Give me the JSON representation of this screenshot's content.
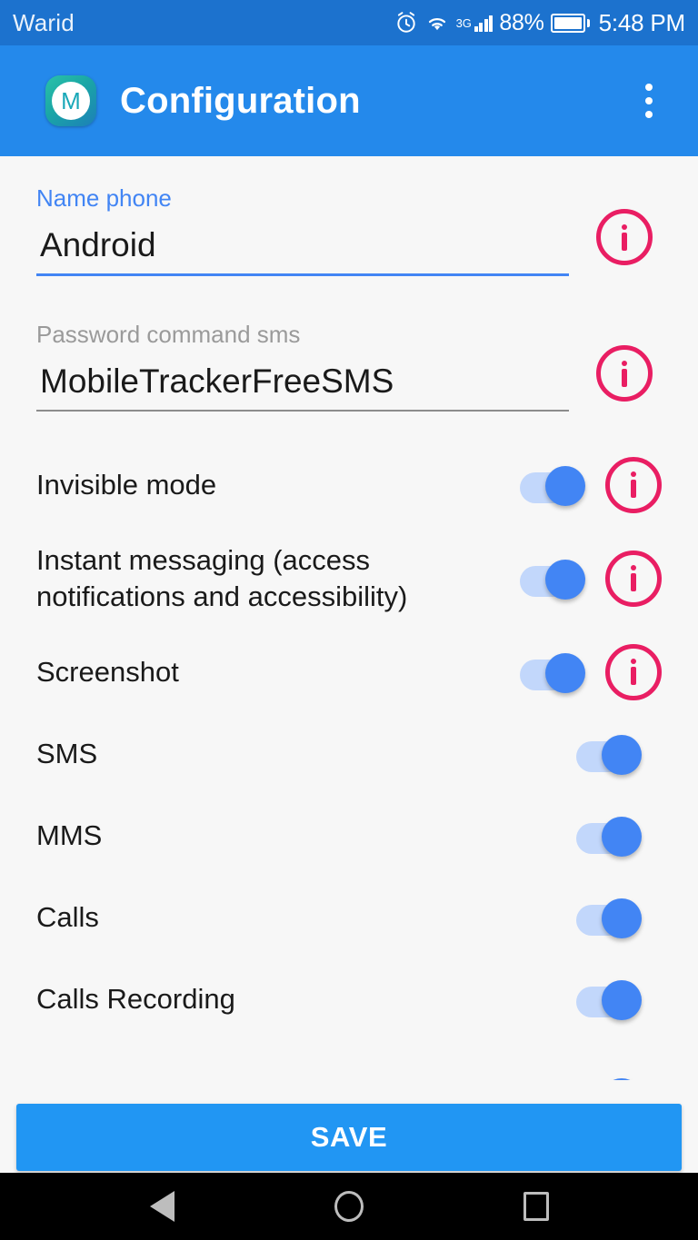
{
  "status_bar": {
    "carrier": "Warid",
    "battery_percent": "88%",
    "network_type": "3G",
    "clock": "5:48 PM",
    "icons": [
      "alarm-icon",
      "wifi-icon",
      "signal-icon",
      "battery-icon"
    ],
    "background_color": "#1C72CE"
  },
  "app_bar": {
    "title": "Configuration",
    "app_icon_letter": "M",
    "overflow_label": "More options",
    "background_color": "#2489EB"
  },
  "form": {
    "name_phone": {
      "label": "Name phone",
      "value": "Android",
      "placeholder": "Name phone",
      "focused": true,
      "label_color": "#4285F4",
      "underline_color": "#4285F4",
      "info_label": "Info Name phone"
    },
    "password_command_sms": {
      "label": "Password command sms",
      "value": "MobileTrackerFreeSMS",
      "placeholder": "Password command sms",
      "focused": false,
      "label_color": "#9A9A9A",
      "underline_color": "#8C8C8C",
      "info_label": "Info Password command sms"
    }
  },
  "settings_rows": [
    {
      "label": "Invisible mode",
      "enabled": true,
      "has_info": true
    },
    {
      "label": "Instant messaging (access notifications and accessibility)",
      "enabled": true,
      "has_info": true
    },
    {
      "label": "Screenshot",
      "enabled": true,
      "has_info": true
    },
    {
      "label": "SMS",
      "enabled": true,
      "has_info": false
    },
    {
      "label": "MMS",
      "enabled": true,
      "has_info": false
    },
    {
      "label": "Calls",
      "enabled": true,
      "has_info": false
    },
    {
      "label": "Calls Recording",
      "enabled": true,
      "has_info": false
    }
  ],
  "footer": {
    "save_label": "SAVE",
    "save_color": "#2196F3"
  },
  "nav_bar": {
    "back_label": "Back",
    "home_label": "Home",
    "recents_label": "Recents"
  },
  "colors": {
    "accent_blue": "#2489EB",
    "status_blue": "#1C72CE",
    "toggle_thumb": "#4285F4",
    "toggle_track": "#C2D7FB",
    "info_pink": "#E91E63",
    "background": "#F7F7F7"
  }
}
